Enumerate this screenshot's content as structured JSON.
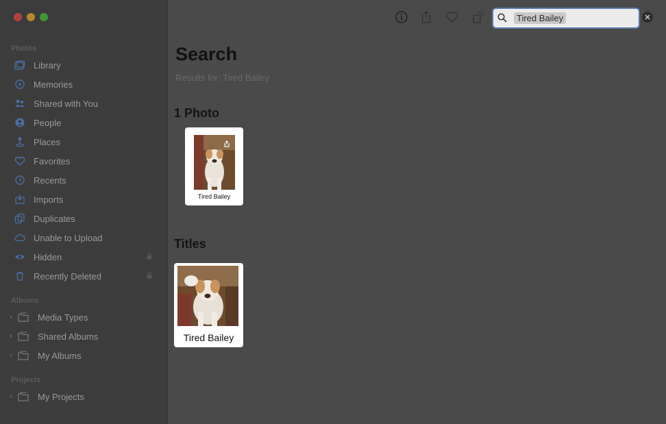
{
  "sidebar": {
    "section_photos": "Photos",
    "items": [
      {
        "label": "Library",
        "icon": "library-icon"
      },
      {
        "label": "Memories",
        "icon": "memories-icon"
      },
      {
        "label": "Shared with You",
        "icon": "shared-with-you-icon"
      },
      {
        "label": "People",
        "icon": "people-icon"
      },
      {
        "label": "Places",
        "icon": "places-icon"
      },
      {
        "label": "Favorites",
        "icon": "heart-icon"
      },
      {
        "label": "Recents",
        "icon": "clock-icon"
      },
      {
        "label": "Imports",
        "icon": "import-icon"
      },
      {
        "label": "Duplicates",
        "icon": "duplicates-icon"
      },
      {
        "label": "Unable to Upload",
        "icon": "cloud-icon"
      },
      {
        "label": "Hidden",
        "icon": "eye-icon"
      },
      {
        "label": "Recently Deleted",
        "icon": "trash-icon"
      }
    ],
    "section_albums": "Albums",
    "albums": [
      {
        "label": "Media Types"
      },
      {
        "label": "Shared Albums"
      },
      {
        "label": "My Albums"
      }
    ],
    "section_projects": "Projects",
    "projects": [
      {
        "label": "My Projects"
      }
    ]
  },
  "search": {
    "query": "Tired Bailey"
  },
  "main": {
    "title": "Search",
    "results_for": "Results for: Tired Bailey",
    "photos_heading": "1 Photo",
    "photo_caption": "Tired Bailey",
    "titles_heading": "Titles",
    "title_caption": "Tired Bailey"
  },
  "colors": {
    "accent": "#5a79a8",
    "dim_overlay": "#4a4a4a"
  }
}
